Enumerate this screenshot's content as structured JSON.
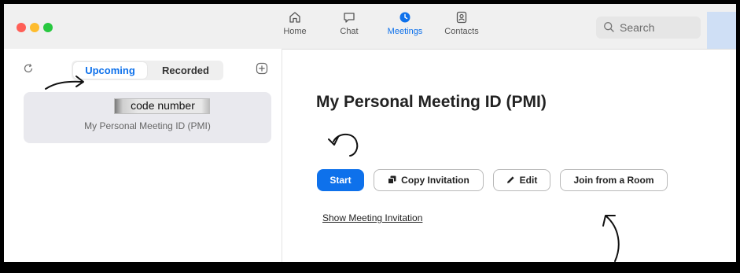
{
  "window": {
    "controls": [
      "close",
      "minimize",
      "zoom"
    ]
  },
  "nav": {
    "tabs": [
      {
        "label": "Home",
        "icon": "home-icon"
      },
      {
        "label": "Chat",
        "icon": "chat-icon"
      },
      {
        "label": "Meetings",
        "icon": "clock-icon",
        "active": true
      },
      {
        "label": "Contacts",
        "icon": "contacts-icon"
      }
    ],
    "search_label": "Search"
  },
  "sidebar": {
    "tabs": {
      "upcoming": "Upcoming",
      "recorded": "Recorded"
    },
    "meeting_card": {
      "code_label": "code number",
      "subtitle": "My Personal Meeting ID (PMI)"
    }
  },
  "main": {
    "title": "My Personal Meeting ID (PMI)",
    "buttons": {
      "start": "Start",
      "copy_invitation": "Copy Invitation",
      "edit": "Edit",
      "join_from_room": "Join from a Room"
    },
    "show_invitation_link": "Show Meeting Invitation"
  },
  "colors": {
    "accent": "#0e71eb",
    "titlebar": "#f0f0f0",
    "card": "#e9e9ee"
  }
}
